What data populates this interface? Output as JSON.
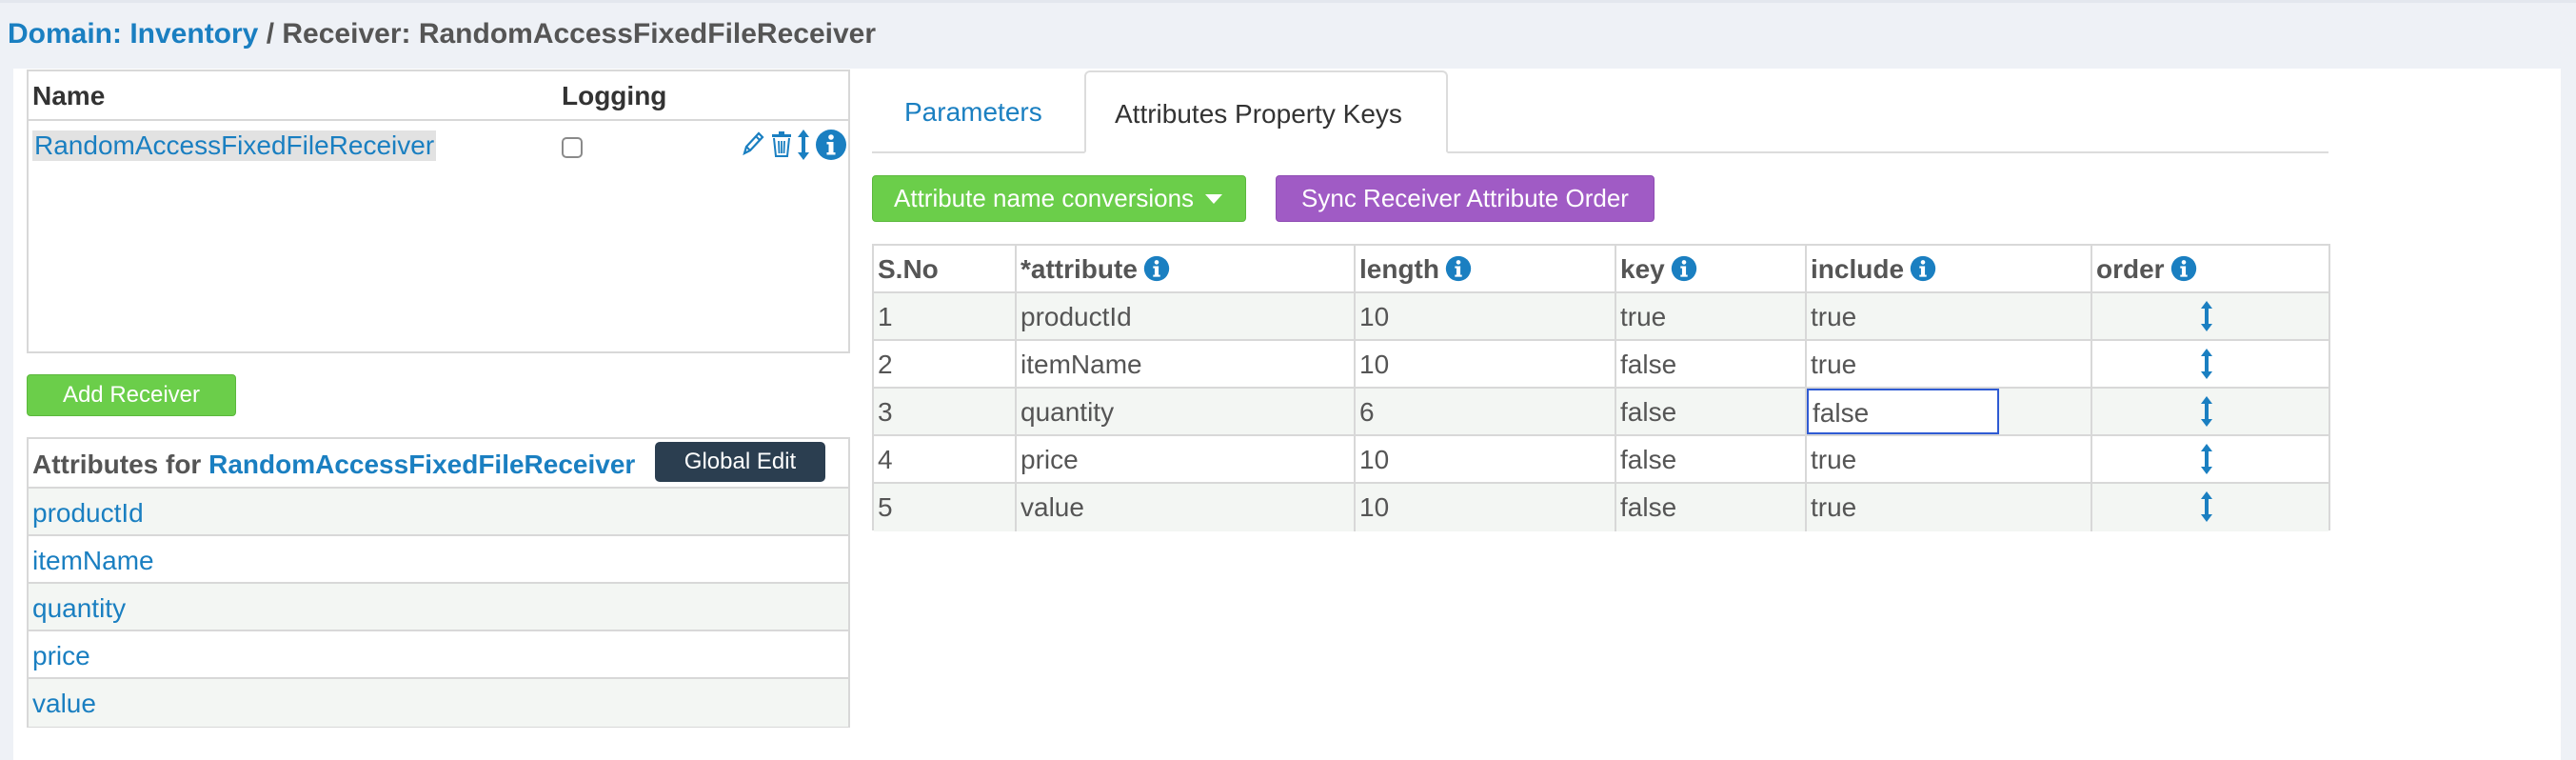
{
  "breadcrumb": {
    "domain_label": "Domain: Inventory",
    "separator": " / ",
    "receiver_label": "Receiver: RandomAccessFixedFileReceiver"
  },
  "receivers_table": {
    "headers": {
      "name": "Name",
      "logging": "Logging"
    },
    "rows": [
      {
        "name": "RandomAccessFixedFileReceiver",
        "logging": false
      }
    ],
    "row_icons": [
      "pencil-icon",
      "trash-icon",
      "vertical-arrows-icon",
      "info-icon"
    ]
  },
  "add_receiver_label": "Add Receiver",
  "attributes_panel": {
    "title_prefix": "Attributes for ",
    "receiver_name": "RandomAccessFixedFileReceiver",
    "global_edit_label": "Global Edit",
    "items": [
      "productId",
      "itemName",
      "quantity",
      "price",
      "value"
    ]
  },
  "tabs": [
    {
      "label": "Parameters",
      "active": false
    },
    {
      "label": "Attributes Property Keys",
      "active": true
    }
  ],
  "actions": {
    "conversions_label": "Attribute name conversions",
    "sync_label": "Sync Receiver Attribute Order"
  },
  "property_table": {
    "headers": {
      "sno": "S.No",
      "attribute": "*attribute",
      "length": "length",
      "key": "key",
      "include": "include",
      "order": "order"
    },
    "rows": [
      {
        "sno": "1",
        "attribute": "productId",
        "length": "10",
        "key": "true",
        "include": "true"
      },
      {
        "sno": "2",
        "attribute": "itemName",
        "length": "10",
        "key": "false",
        "include": "true"
      },
      {
        "sno": "3",
        "attribute": "quantity",
        "length": "6",
        "key": "false",
        "include": "false"
      },
      {
        "sno": "4",
        "attribute": "price",
        "length": "10",
        "key": "false",
        "include": "true"
      },
      {
        "sno": "5",
        "attribute": "value",
        "length": "10",
        "key": "false",
        "include": "true"
      }
    ],
    "editing_row": 2,
    "editing_column": "include"
  },
  "colors": {
    "link_blue": "#1a7fc1",
    "green_button": "#6bce4a",
    "purple_button": "#a05bc5",
    "dark_button": "#2b3e50",
    "edit_border": "#2f5bd3"
  }
}
